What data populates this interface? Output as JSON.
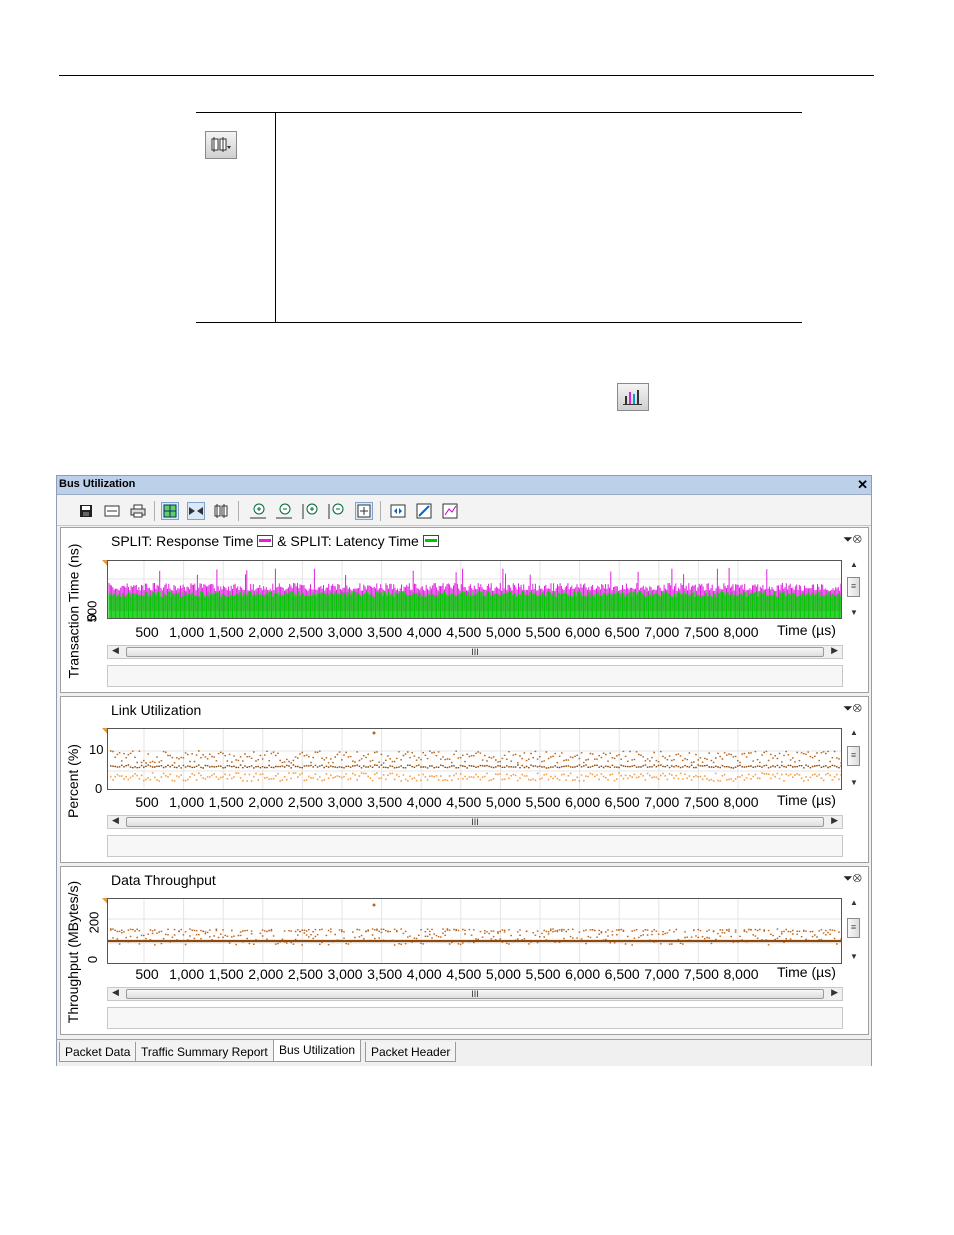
{
  "window": {
    "title": "Bus Utilization",
    "close_glyph": "✕",
    "toolbar_icons": [
      "save-icon",
      "card-icon",
      "print-icon",
      "grid-icon",
      "align-icon",
      "config-icon",
      "zoom-in-horizontal-icon",
      "zoom-out-horizontal-icon",
      "zoom-in-vertical-icon",
      "zoom-out-vertical-icon",
      "crosshair-icon",
      "fit-icon",
      "expand-icon",
      "chart-edit-icon"
    ]
  },
  "panels": [
    {
      "title": "SPLIT: Response Time",
      "title_join": "& SPLIT: Latency Time",
      "ylabel": "Transaction Time (ns)",
      "yticks": [
        "0",
        "500"
      ],
      "xticks": [
        "500",
        "1,000",
        "1,500",
        "2,000",
        "2,500",
        "3,000",
        "3,500",
        "4,000",
        "4,500",
        "5,000",
        "5,500",
        "6,000",
        "6,500",
        "7,000",
        "7,500",
        "8,000"
      ],
      "xtitle": "Time (µs)",
      "scroll_grip": "III"
    },
    {
      "title": "Link Utilization",
      "ylabel": "Percent (%)",
      "yticks": [
        "0",
        "10"
      ],
      "xticks": [
        "500",
        "1,000",
        "1,500",
        "2,000",
        "2,500",
        "3,000",
        "3,500",
        "4,000",
        "4,500",
        "5,000",
        "5,500",
        "6,000",
        "6,500",
        "7,000",
        "7,500",
        "8,000"
      ],
      "xtitle": "Time (µs)",
      "scroll_grip": "III"
    },
    {
      "title": "Data Throughput",
      "ylabel": "Throughput (MBytes/s)",
      "yticks": [
        "0",
        "200"
      ],
      "xticks": [
        "500",
        "1,000",
        "1,500",
        "2,000",
        "2,500",
        "3,000",
        "3,500",
        "4,000",
        "4,500",
        "5,000",
        "5,500",
        "6,000",
        "6,500",
        "7,000",
        "7,500",
        "8,000"
      ],
      "xtitle": "Time (µs)",
      "scroll_grip": "III"
    }
  ],
  "tabs": [
    "Packet Data",
    "Traffic Summary Report",
    "Bus Utilization",
    "Packet Header"
  ],
  "selected_tab": "Bus Utilization",
  "colors": {
    "response": "#e020e0",
    "latency": "#00c800",
    "util_dark": "#b5651d",
    "util_light": "#f5a04a",
    "throughput": "#c0661a"
  }
}
